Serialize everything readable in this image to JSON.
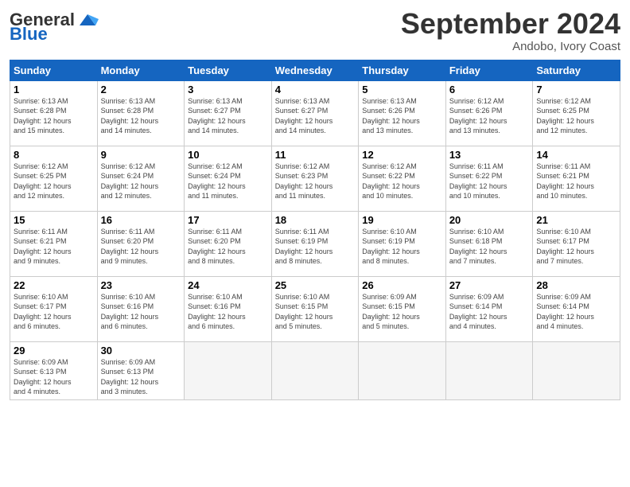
{
  "logo": {
    "line1": "General",
    "line2": "Blue"
  },
  "title": "September 2024",
  "subtitle": "Andobo, Ivory Coast",
  "days_of_week": [
    "Sunday",
    "Monday",
    "Tuesday",
    "Wednesday",
    "Thursday",
    "Friday",
    "Saturday"
  ],
  "weeks": [
    [
      {
        "day": 1,
        "info": "Sunrise: 6:13 AM\nSunset: 6:28 PM\nDaylight: 12 hours\nand 15 minutes."
      },
      {
        "day": 2,
        "info": "Sunrise: 6:13 AM\nSunset: 6:28 PM\nDaylight: 12 hours\nand 14 minutes."
      },
      {
        "day": 3,
        "info": "Sunrise: 6:13 AM\nSunset: 6:27 PM\nDaylight: 12 hours\nand 14 minutes."
      },
      {
        "day": 4,
        "info": "Sunrise: 6:13 AM\nSunset: 6:27 PM\nDaylight: 12 hours\nand 14 minutes."
      },
      {
        "day": 5,
        "info": "Sunrise: 6:13 AM\nSunset: 6:26 PM\nDaylight: 12 hours\nand 13 minutes."
      },
      {
        "day": 6,
        "info": "Sunrise: 6:12 AM\nSunset: 6:26 PM\nDaylight: 12 hours\nand 13 minutes."
      },
      {
        "day": 7,
        "info": "Sunrise: 6:12 AM\nSunset: 6:25 PM\nDaylight: 12 hours\nand 12 minutes."
      }
    ],
    [
      {
        "day": 8,
        "info": "Sunrise: 6:12 AM\nSunset: 6:25 PM\nDaylight: 12 hours\nand 12 minutes."
      },
      {
        "day": 9,
        "info": "Sunrise: 6:12 AM\nSunset: 6:24 PM\nDaylight: 12 hours\nand 12 minutes."
      },
      {
        "day": 10,
        "info": "Sunrise: 6:12 AM\nSunset: 6:24 PM\nDaylight: 12 hours\nand 11 minutes."
      },
      {
        "day": 11,
        "info": "Sunrise: 6:12 AM\nSunset: 6:23 PM\nDaylight: 12 hours\nand 11 minutes."
      },
      {
        "day": 12,
        "info": "Sunrise: 6:12 AM\nSunset: 6:22 PM\nDaylight: 12 hours\nand 10 minutes."
      },
      {
        "day": 13,
        "info": "Sunrise: 6:11 AM\nSunset: 6:22 PM\nDaylight: 12 hours\nand 10 minutes."
      },
      {
        "day": 14,
        "info": "Sunrise: 6:11 AM\nSunset: 6:21 PM\nDaylight: 12 hours\nand 10 minutes."
      }
    ],
    [
      {
        "day": 15,
        "info": "Sunrise: 6:11 AM\nSunset: 6:21 PM\nDaylight: 12 hours\nand 9 minutes."
      },
      {
        "day": 16,
        "info": "Sunrise: 6:11 AM\nSunset: 6:20 PM\nDaylight: 12 hours\nand 9 minutes."
      },
      {
        "day": 17,
        "info": "Sunrise: 6:11 AM\nSunset: 6:20 PM\nDaylight: 12 hours\nand 8 minutes."
      },
      {
        "day": 18,
        "info": "Sunrise: 6:11 AM\nSunset: 6:19 PM\nDaylight: 12 hours\nand 8 minutes."
      },
      {
        "day": 19,
        "info": "Sunrise: 6:10 AM\nSunset: 6:19 PM\nDaylight: 12 hours\nand 8 minutes."
      },
      {
        "day": 20,
        "info": "Sunrise: 6:10 AM\nSunset: 6:18 PM\nDaylight: 12 hours\nand 7 minutes."
      },
      {
        "day": 21,
        "info": "Sunrise: 6:10 AM\nSunset: 6:17 PM\nDaylight: 12 hours\nand 7 minutes."
      }
    ],
    [
      {
        "day": 22,
        "info": "Sunrise: 6:10 AM\nSunset: 6:17 PM\nDaylight: 12 hours\nand 6 minutes."
      },
      {
        "day": 23,
        "info": "Sunrise: 6:10 AM\nSunset: 6:16 PM\nDaylight: 12 hours\nand 6 minutes."
      },
      {
        "day": 24,
        "info": "Sunrise: 6:10 AM\nSunset: 6:16 PM\nDaylight: 12 hours\nand 6 minutes."
      },
      {
        "day": 25,
        "info": "Sunrise: 6:10 AM\nSunset: 6:15 PM\nDaylight: 12 hours\nand 5 minutes."
      },
      {
        "day": 26,
        "info": "Sunrise: 6:09 AM\nSunset: 6:15 PM\nDaylight: 12 hours\nand 5 minutes."
      },
      {
        "day": 27,
        "info": "Sunrise: 6:09 AM\nSunset: 6:14 PM\nDaylight: 12 hours\nand 4 minutes."
      },
      {
        "day": 28,
        "info": "Sunrise: 6:09 AM\nSunset: 6:14 PM\nDaylight: 12 hours\nand 4 minutes."
      }
    ],
    [
      {
        "day": 29,
        "info": "Sunrise: 6:09 AM\nSunset: 6:13 PM\nDaylight: 12 hours\nand 4 minutes."
      },
      {
        "day": 30,
        "info": "Sunrise: 6:09 AM\nSunset: 6:13 PM\nDaylight: 12 hours\nand 3 minutes."
      },
      null,
      null,
      null,
      null,
      null
    ]
  ]
}
